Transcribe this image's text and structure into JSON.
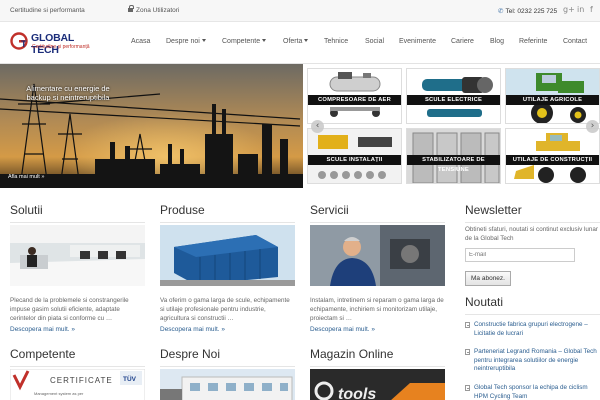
{
  "topbar": {
    "tagline": "Certitudine si performanta",
    "user_zone": "Zona Utilizatori",
    "phone": "Tel: 0232 225 725",
    "social": [
      "g+",
      "in",
      "f"
    ]
  },
  "logo": {
    "name": "GLOBAL TECH",
    "subtitle": "Certitudine și performanță"
  },
  "nav": {
    "items": [
      {
        "label": "Acasa",
        "dropdown": false
      },
      {
        "label": "Despre noi",
        "dropdown": true
      },
      {
        "label": "Competente",
        "dropdown": true
      },
      {
        "label": "Oferta",
        "dropdown": true
      },
      {
        "label": "Tehnice",
        "dropdown": false
      },
      {
        "label": "Social",
        "dropdown": false
      },
      {
        "label": "Evenimente",
        "dropdown": false
      },
      {
        "label": "Cariere",
        "dropdown": false
      },
      {
        "label": "Blog",
        "dropdown": false
      },
      {
        "label": "Referinte",
        "dropdown": false
      },
      {
        "label": "Contact",
        "dropdown": false
      }
    ]
  },
  "hero": {
    "caption": "Alimentare cu energie de backup si neintreruptibila",
    "more": "Afla mai mult »"
  },
  "products": [
    {
      "label": "COMPRESOARE DE AER"
    },
    {
      "label": "SCULE ELECTRICE"
    },
    {
      "label": "UTILAJE AGRICOLE"
    },
    {
      "label": "SCULE INSTALAȚII"
    },
    {
      "label": "STABILIZATOARE DE TENSIUNE"
    },
    {
      "label": "UTILAJE DE CONSTRUCȚII"
    }
  ],
  "carousel": {
    "prev": "‹",
    "next": "›"
  },
  "sections": {
    "solutii": {
      "title": "Solutii",
      "text": "Plecand de la problemele si constrangerile impuse gasim solutii eficiente, adaptate cerintelor din piata si conforme cu …",
      "more": "Descopera mai mult. »"
    },
    "produse": {
      "title": "Produse",
      "text": "Va oferim o gama larga de scule, echipamente si utilaje profesionale pentru industrie, agricultura si constructii …",
      "more": "Descopera mai mult. »"
    },
    "servicii": {
      "title": "Servicii",
      "text": "Instalam, intretinem si reparam o gama larga de echipamente, inchiriem si monitorizam utilaje, proiectam si …",
      "more": "Descopera mai mult. »"
    },
    "competente": {
      "title": "Competente",
      "cert_text": "CERTIFICATE",
      "cert_sub": "Management system as per",
      "tuv": "TÜV"
    },
    "despre": {
      "title": "Despre Noi"
    },
    "magazin": {
      "title": "Magazin Online",
      "logo": "tools"
    }
  },
  "newsletter": {
    "title": "Newsletter",
    "text": "Obtineti sfaturi, noutati si continut exclusiv lunar de la Global Tech",
    "placeholder": "E-mail",
    "button": "Ma abonez."
  },
  "noutati": {
    "title": "Noutati",
    "items": [
      "Constructie fabrica grupuri electrogene – Licitatie de lucrari",
      "Parteneriat Legrand Romania – Global Tech pentru integrarea solutiilor de energie neintreruptibila",
      "Global Tech sponsor la echipa de ciclism HPM Cycling Team"
    ]
  },
  "colors": {
    "link": "#2a5d8f",
    "brand_blue": "#1b2d7a",
    "brand_red": "#c0302a",
    "tile_label_bg": "#111111"
  }
}
